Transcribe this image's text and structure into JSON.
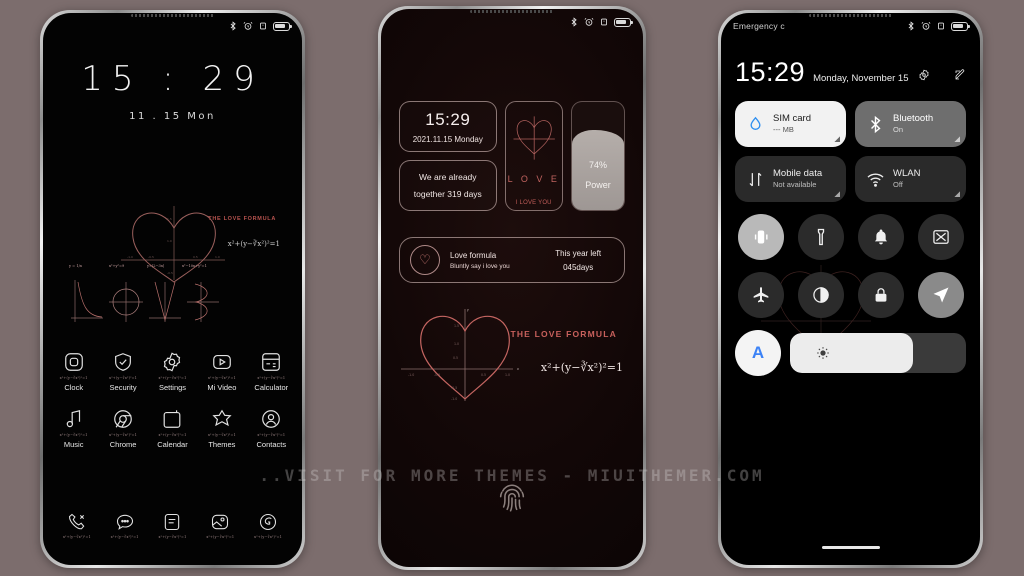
{
  "background_color": "#7c6d6d",
  "watermark": "..VISIT FOR MORE THEMES - MIUITHEMER.COM",
  "theme": {
    "accent_red": "#c0635f",
    "accent_blue": "#3b82f6"
  },
  "phone1": {
    "statusbar": {
      "icons": [
        "bluetooth-icon",
        "alarm-icon",
        "vibrate-icon",
        "battery-icon"
      ]
    },
    "lock": {
      "time": "15 : 29",
      "date": "11 . 15  Mon"
    },
    "art": {
      "formula_label": "THE LOVE FORMULA",
      "formula_eq": "x²+(y−∛x²)²=1",
      "love_equations": [
        "y = 1/x",
        "x²+y²=9",
        "y=|2−3x|",
        "x²−10x+y²=1"
      ]
    },
    "apps_row1": [
      {
        "label": "Clock",
        "icon": "clock-app-icon",
        "sub": "x²+(y−∛x²)²=1"
      },
      {
        "label": "Security",
        "icon": "security-shield-icon",
        "sub": "x²+(y−∛x²)²=1"
      },
      {
        "label": "Settings",
        "icon": "settings-gear-icon",
        "sub": "x²+(y−∛x²)²=1"
      },
      {
        "label": "Mi Video",
        "icon": "video-play-icon",
        "sub": "x²+(y−∛x²)²=1"
      },
      {
        "label": "Calculator",
        "icon": "calculator-icon",
        "sub": "x²+(y−∛x²)²=1"
      }
    ],
    "apps_row2": [
      {
        "label": "Music",
        "icon": "music-note-icon",
        "sub": "x²+(y−∛x²)²=1"
      },
      {
        "label": "Chrome",
        "icon": "chrome-browser-icon",
        "sub": "x²+(y−∛x²)²=1"
      },
      {
        "label": "Calendar",
        "icon": "calendar-icon",
        "sub": "x²+(y−∛x²)²=1"
      },
      {
        "label": "Themes",
        "icon": "themes-star-icon",
        "sub": "x²+(y−∛x²)²=1"
      },
      {
        "label": "Contacts",
        "icon": "contacts-person-icon",
        "sub": "x²+(y−∛x²)²=1"
      }
    ],
    "dock": [
      {
        "label": "",
        "icon": "phone-dial-icon",
        "sub": "x²+(y−∛x²)²=1"
      },
      {
        "label": "",
        "icon": "messages-bubble-icon",
        "sub": "x²+(y−∛x²)²=1"
      },
      {
        "label": "",
        "icon": "notes-icon",
        "sub": "x²+(y−∛x²)²=1"
      },
      {
        "label": "",
        "icon": "gallery-icon",
        "sub": "x²+(y−∛x²)²=1"
      },
      {
        "label": "",
        "icon": "browser-icon",
        "sub": "x²+(y−∛x²)²=1"
      }
    ]
  },
  "phone2": {
    "statusbar": {
      "icons": [
        "bluetooth-icon",
        "alarm-icon",
        "vibrate-icon",
        "battery-icon"
      ]
    },
    "widget_clock": {
      "time": "15:29",
      "date": "2021.11.15 Monday"
    },
    "widget_days": {
      "line1": "We are already",
      "line2": "together  319  days"
    },
    "widget_love_letters": {
      "letters": "L O V E",
      "tag": "I LOVE YOU"
    },
    "widget_battery": {
      "percent": "74%",
      "label": "Power"
    },
    "widget_formula": {
      "title": "Love formula",
      "subtitle": "Bluntly say i love you",
      "right_title": "This year left",
      "right_value": "045days",
      "icon": "heart-outline-icon"
    },
    "art": {
      "title": "THE LOVE FORMULA",
      "equation": "x²+(y−∛x²)²=1"
    },
    "fingerprint_icon": "fingerprint-icon"
  },
  "phone3": {
    "statusbar": {
      "carrier": "Emergency c",
      "icons": [
        "bluetooth-icon",
        "alarm-icon",
        "vibrate-icon",
        "battery-icon"
      ]
    },
    "header": {
      "time": "15:29",
      "date": "Monday, November 15",
      "settings_icon": "gear-icon",
      "edit_icon": "edit-icon"
    },
    "tiles": [
      {
        "title": "SIM card",
        "subtitle": "--- MB",
        "state": "on",
        "icon": "data-droplet-icon"
      },
      {
        "title": "Bluetooth",
        "subtitle": "On",
        "state": "mid",
        "icon": "bluetooth-icon"
      },
      {
        "title": "Mobile data",
        "subtitle": "Not available",
        "state": "off",
        "icon": "mobile-data-icon"
      },
      {
        "title": "WLAN",
        "subtitle": "Off",
        "state": "off",
        "icon": "wifi-icon"
      }
    ],
    "circles_row1": [
      {
        "name": "vibrate",
        "state": "on",
        "icon": "vibrate-icon"
      },
      {
        "name": "flashlight",
        "state": "off",
        "icon": "flashlight-icon"
      },
      {
        "name": "silent",
        "state": "off",
        "icon": "bell-icon"
      },
      {
        "name": "screenshot",
        "state": "off",
        "icon": "screenshot-icon"
      }
    ],
    "circles_row2": [
      {
        "name": "airplane",
        "state": "off",
        "icon": "airplane-icon"
      },
      {
        "name": "dark-mode",
        "state": "off",
        "icon": "contrast-icon"
      },
      {
        "name": "lock",
        "state": "off",
        "icon": "lock-icon"
      },
      {
        "name": "location",
        "state": "light",
        "icon": "location-arrow-icon"
      }
    ],
    "brightness": {
      "auto_label": "A",
      "level_percent": 70,
      "icon": "brightness-sun-icon"
    }
  }
}
